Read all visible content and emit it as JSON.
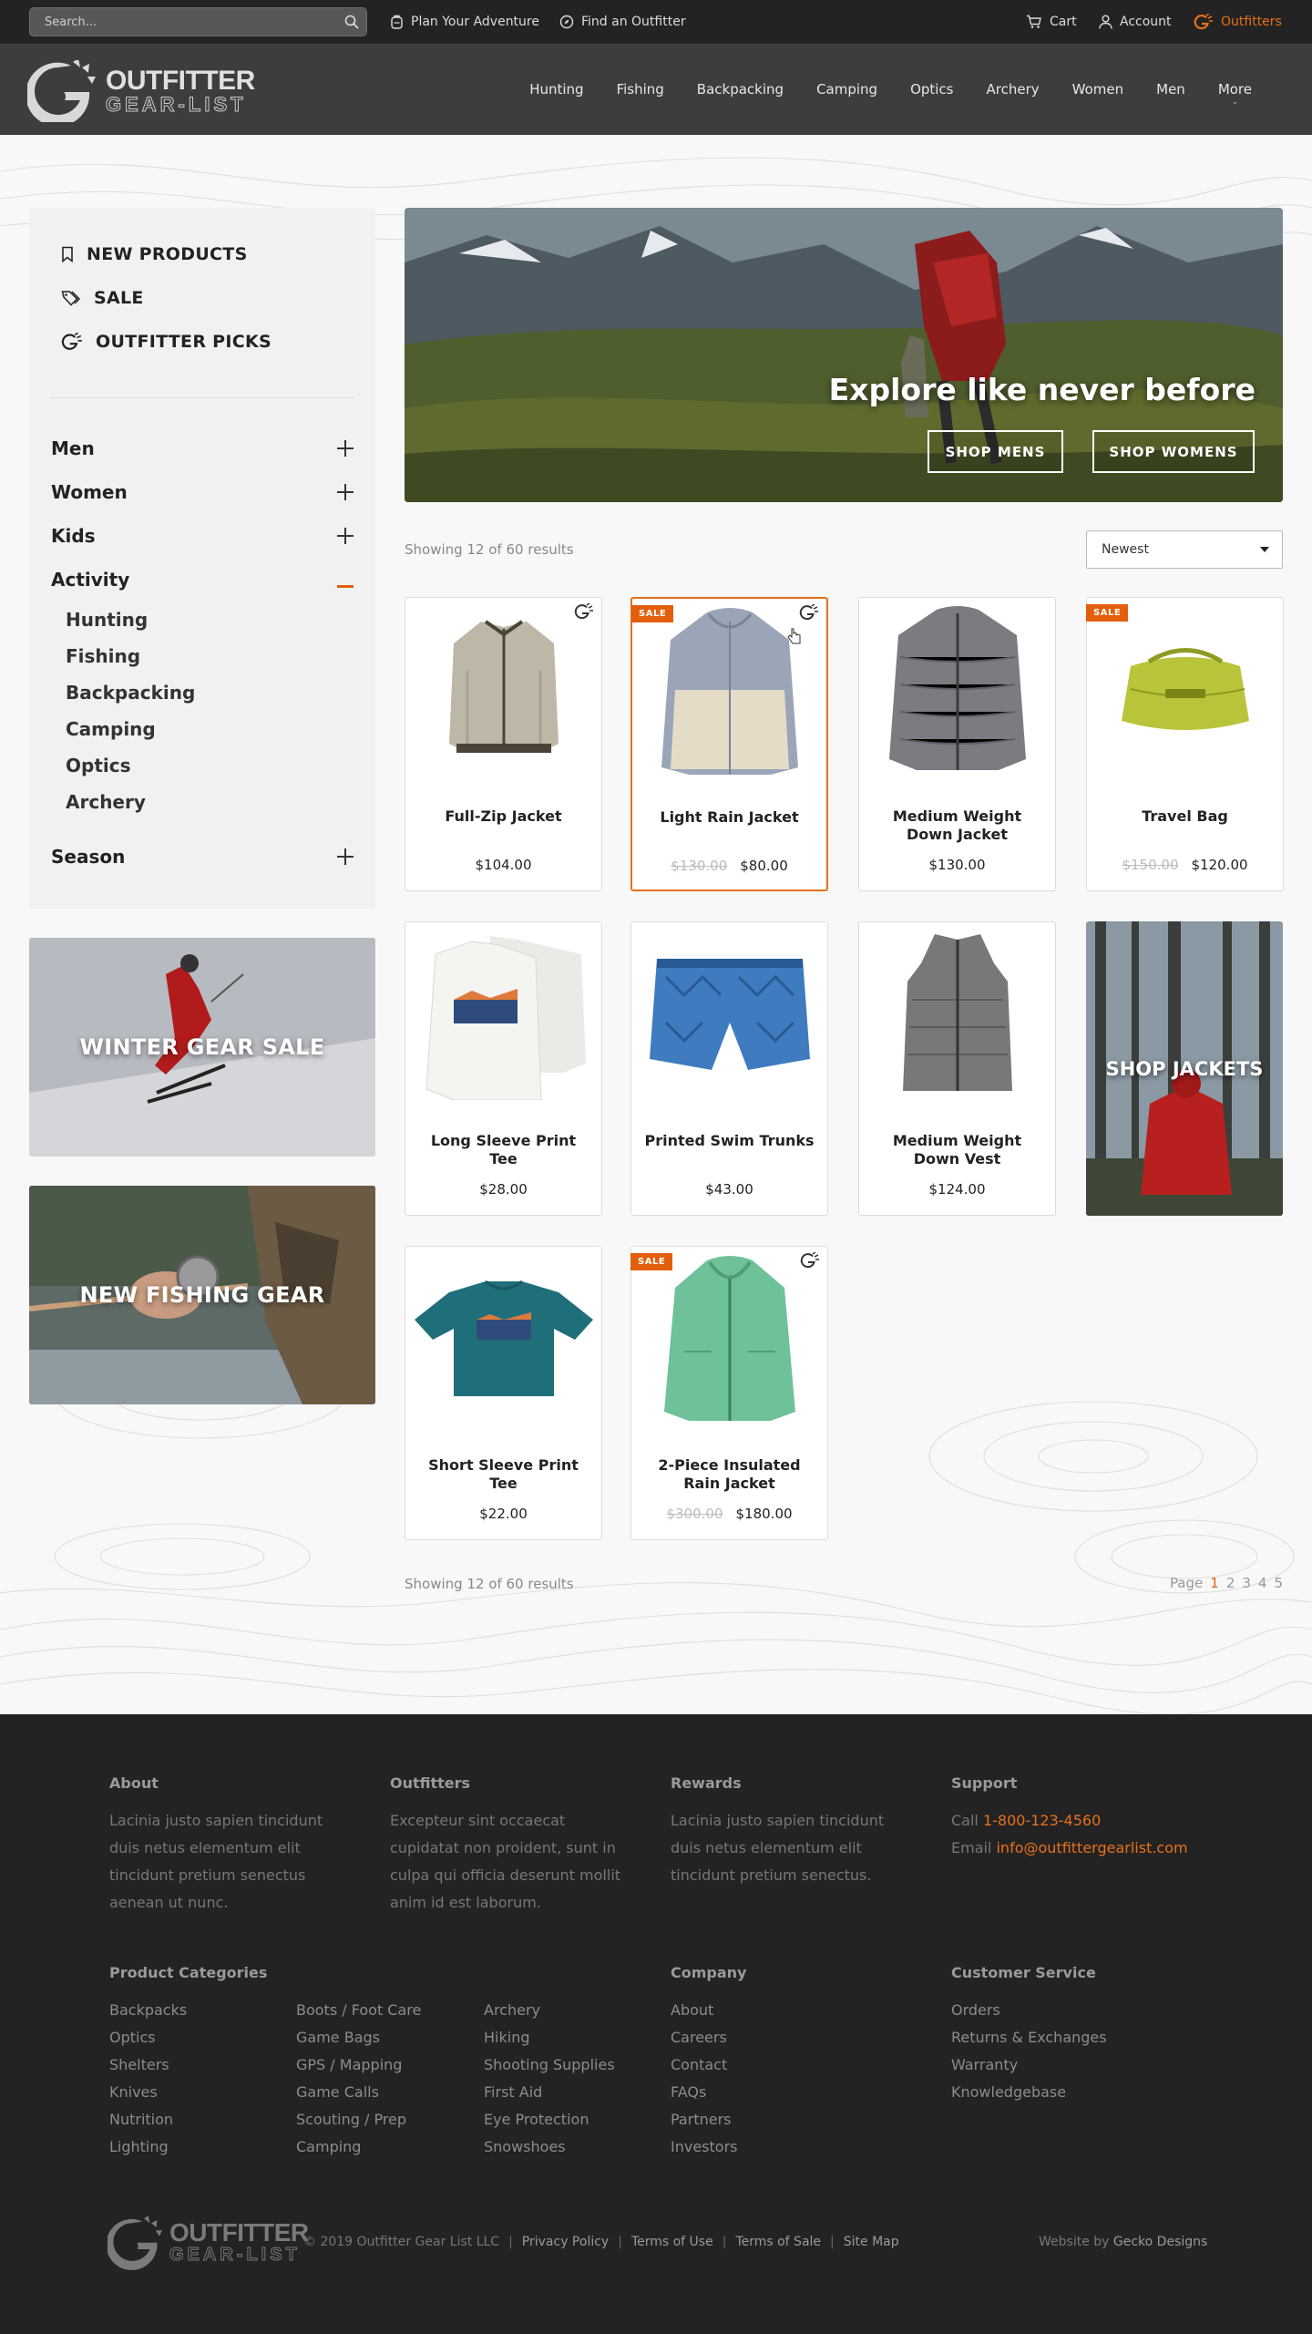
{
  "topbar": {
    "search_placeholder": "Search...",
    "links": [
      "Plan Your Adventure",
      "Find an Outfitter"
    ],
    "cart": "Cart",
    "account": "Account",
    "outfitters": "Outfitters"
  },
  "brand": {
    "line1": "OUTFITTER",
    "line2": "GEAR-LIST"
  },
  "nav": [
    "Hunting",
    "Fishing",
    "Backpacking",
    "Camping",
    "Optics",
    "Archery",
    "Women",
    "Men",
    "More"
  ],
  "sidebar": {
    "top": [
      "NEW PRODUCTS",
      "SALE",
      "OUTFITTER PICKS"
    ],
    "categories": [
      "Men",
      "Women",
      "Kids",
      "Activity",
      "Season"
    ],
    "activity_items": [
      "Hunting",
      "Fishing",
      "Backpacking",
      "Camping",
      "Optics",
      "Archery"
    ]
  },
  "promos": {
    "winter": "WINTER GEAR SALE",
    "fishing": "NEW FISHING GEAR",
    "jackets": "SHOP JACKETS"
  },
  "hero": {
    "title": "Explore like never before",
    "btn_mens": "SHOP MENS",
    "btn_womens": "SHOP WOMENS"
  },
  "results": {
    "text": "Showing 12 of 60 results",
    "sort": "Newest"
  },
  "badge_sale": "SALE",
  "products": [
    {
      "name": "Full-Zip Jacket",
      "price": "$104.00",
      "old": ""
    },
    {
      "name": "Light Rain Jacket",
      "price": "$80.00",
      "old": "$130.00"
    },
    {
      "name": "Medium Weight Down Jacket",
      "price": "$130.00",
      "old": ""
    },
    {
      "name": "Travel Bag",
      "price": "$120.00",
      "old": "$150.00"
    },
    {
      "name": "Long Sleeve Print Tee",
      "price": "$28.00",
      "old": ""
    },
    {
      "name": "Printed Swim Trunks",
      "price": "$43.00",
      "old": ""
    },
    {
      "name": "Medium Weight Down Vest",
      "price": "$124.00",
      "old": ""
    },
    {
      "name": "Short Sleeve Print Tee",
      "price": "$22.00",
      "old": ""
    },
    {
      "name": "2-Piece Insulated Rain Jacket",
      "price": "$180.00",
      "old": "$300.00"
    }
  ],
  "pager": {
    "label": "Page",
    "pages": [
      "1",
      "2",
      "3",
      "4",
      "5"
    ],
    "current": "1"
  },
  "footer": {
    "about_h": "About",
    "about_t": "Lacinia justo sapien tincidunt duis netus elementum elit tincidunt pretium senectus aenean ut nunc.",
    "outfitters_h": "Outfitters",
    "outfitters_t": "Excepteur sint occaecat cupidatat non proident, sunt in culpa qui officia deserunt mollit anim id est laborum.",
    "rewards_h": "Rewards",
    "rewards_t": "Lacinia justo sapien tincidunt duis netus elementum elit tincidunt pretium senectus.",
    "support_h": "Support",
    "call_label": "Call",
    "phone": "1-800-123-4560",
    "email_label": "Email",
    "email": "info@outfittergearlist.com",
    "cat_h": "Product Categories",
    "cat_col1": [
      "Backpacks",
      "Optics",
      "Shelters",
      "Knives",
      "Nutrition",
      "Lighting"
    ],
    "cat_col2": [
      "Boots / Foot Care",
      "Game Bags",
      "GPS / Mapping",
      "Game Calls",
      "Scouting / Prep",
      "Camping"
    ],
    "cat_col3": [
      "Archery",
      "Hiking",
      "Shooting Supplies",
      "First Aid",
      "Eye Protection",
      "Snowshoes"
    ],
    "company_h": "Company",
    "company": [
      "About",
      "Careers",
      "Contact",
      "FAQs",
      "Partners",
      "Investors"
    ],
    "cs_h": "Customer Service",
    "cs": [
      "Orders",
      "Returns & Exchanges",
      "Warranty",
      "Knowledgebase"
    ],
    "copyright": "© 2019 Outfitter Gear List LLC",
    "legal": [
      "Privacy Policy",
      "Terms of Use",
      "Terms of Sale",
      "Site Map"
    ],
    "website_by": "Website by",
    "designer": "Gecko Designs"
  },
  "colors": {
    "accent": "#e35f0d",
    "topbar": "#232323",
    "header": "#3d3d3d",
    "footer": "#232323"
  }
}
